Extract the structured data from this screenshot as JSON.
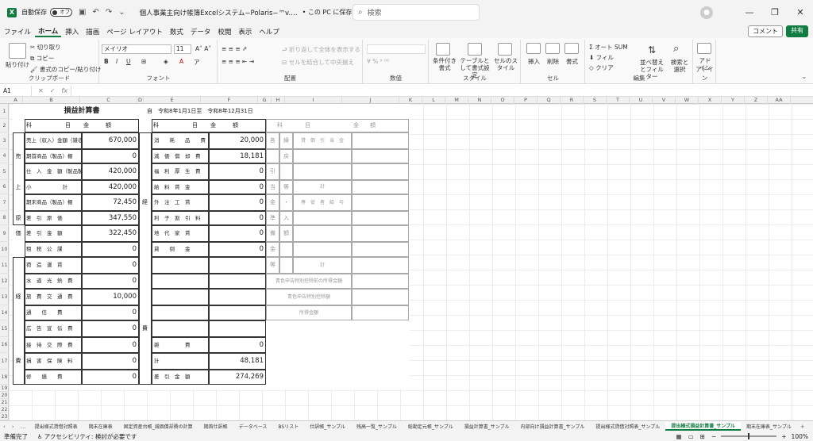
{
  "titlebar": {
    "autosave_label": "自動保存",
    "autosave_state": "オフ",
    "doc_title": "個人事業主向け帳簿Excelシステム−Polaris−™v.…",
    "save_location": "• この PC に保存済み",
    "search_placeholder": "検索"
  },
  "menu": {
    "items": [
      "ファイル",
      "ホーム",
      "挿入",
      "描画",
      "ページ レイアウト",
      "数式",
      "データ",
      "校閲",
      "表示",
      "ヘルプ"
    ],
    "comment": "コメント",
    "share": "共有"
  },
  "ribbon": {
    "clipboard": {
      "paste": "貼り付け",
      "cut": "切り取り",
      "copy": "コピー",
      "format_painter": "書式のコピー/貼り付け",
      "label": "クリップボード"
    },
    "font": {
      "name": "メイリオ",
      "size": "11",
      "label": "フォント"
    },
    "alignment": {
      "wrap": "折り返して全体を表示する",
      "merge": "セルを結合して中央揃え",
      "label": "配置"
    },
    "number": {
      "label": "数値"
    },
    "styles": {
      "conditional": "条件付き書式",
      "table": "テーブルとして書式設定",
      "cell_styles": "セルのスタイル",
      "label": "スタイル"
    },
    "cells": {
      "insert": "挿入",
      "delete": "削除",
      "format": "書式",
      "label": "セル"
    },
    "editing": {
      "autosum": "オート SUM",
      "fill": "フィル",
      "clear": "クリア",
      "sort": "並べ替えとフィルター",
      "find": "検索と選択",
      "label": "編集"
    },
    "addins": {
      "addin": "アドイン",
      "label": "アドイン"
    }
  },
  "formula": {
    "namebox": "A1",
    "fx": "fx"
  },
  "columns": [
    "A",
    "B",
    "C",
    "D",
    "E",
    "F",
    "G",
    "H",
    "I",
    "J",
    "K",
    "L",
    "M",
    "N",
    "O",
    "P",
    "Q",
    "R",
    "S",
    "T",
    "U",
    "V",
    "W",
    "X",
    "Y",
    "Z",
    "AA"
  ],
  "rows": [
    "1",
    "2",
    "3",
    "4",
    "5",
    "6",
    "7",
    "8",
    "9",
    "10",
    "11",
    "12",
    "13",
    "14",
    "15",
    "16",
    "17",
    "18",
    "19",
    "20",
    "21",
    "22",
    "23",
    "24",
    "25"
  ],
  "statement": {
    "title": "損益計算書",
    "period": "自　令和8年1月1日至　令和8年12月31日",
    "hdr_item": "科　　　　　　目",
    "hdr_amount": "金　　　額",
    "left_rows": [
      {
        "label": "売上（収入）金額（雑収入を含む）",
        "value": "670,000"
      },
      {
        "label": "期首商品（製品）棚　　卸　　高",
        "value": "0"
      },
      {
        "label": "仕　入　金　額（製品製造原価）",
        "value": "420,000"
      },
      {
        "label": "小　　　　　　計",
        "value": "420,000"
      },
      {
        "label": "期末商品（製品）棚　　卸　　高",
        "value": "72,450"
      },
      {
        "label": "差　引　原　価",
        "value": "347,550"
      },
      {
        "label": "差　引　金　額",
        "value": "322,450"
      },
      {
        "label": "租　税　公　課",
        "value": "0"
      },
      {
        "label": "荷　造　運　賃",
        "value": "0"
      },
      {
        "label": "水　道　光　熱　費",
        "value": "0"
      },
      {
        "label": "旅　費　交　通　費",
        "value": "10,000"
      },
      {
        "label": "通　　信　　費",
        "value": "0"
      },
      {
        "label": "広　告　宣　伝　費",
        "value": "0"
      },
      {
        "label": "接　待　交　際　費",
        "value": "0"
      },
      {
        "label": "損　害　保　険　料",
        "value": "0"
      },
      {
        "label": "修　　繕　　費",
        "value": "0"
      }
    ],
    "right_rows": [
      {
        "label": "消　　耗　　品　　費",
        "value": "20,000"
      },
      {
        "label": "減　価　償　却　費",
        "value": "18,181"
      },
      {
        "label": "福　利　厚　生　費",
        "value": "0"
      },
      {
        "label": "給　料　賃　金",
        "value": "0"
      },
      {
        "label": "外　注　工　賃",
        "value": "0"
      },
      {
        "label": "利　子　割　引　料",
        "value": "0"
      },
      {
        "label": "地　代　家　賃",
        "value": "0"
      },
      {
        "label": "貸　　倒　　金",
        "value": "0"
      },
      {
        "label": "",
        "value": ""
      },
      {
        "label": "",
        "value": ""
      },
      {
        "label": "",
        "value": ""
      },
      {
        "label": "",
        "value": ""
      },
      {
        "label": "",
        "value": ""
      },
      {
        "label": "雑　　　　　費",
        "value": "0"
      },
      {
        "label": "計",
        "value": "48,181"
      },
      {
        "label": "差　引　金　額",
        "value": "274,269"
      }
    ],
    "side_left": {
      "uri": "売",
      "ue": "上",
      "gen": "原",
      "ka": "価",
      "kei": "経",
      "hi": "費"
    },
    "side_mid": {
      "kei": "経",
      "hi": "費"
    },
    "far": {
      "hdr_item": "科　　　　目",
      "hdr_amount": "金　　額",
      "col_g": [
        "各",
        "",
        "引",
        "当",
        "金",
        "準",
        "備",
        "金",
        "等"
      ],
      "col_h": [
        "繰",
        "戻",
        "",
        "等",
        "・",
        "入",
        "額",
        "",
        ""
      ],
      "col_i_r3": "貸　倒　引　当　金",
      "col_i_r6": "計",
      "col_i_r7": "専　従　者　給　与",
      "col_i_r8": "貸　倒　引　当　金",
      "col_i_r11": "計",
      "blue1": "青色申告特別控除前の所得金額",
      "blue2": "青色申告特別控除額",
      "blue3": "所得金額"
    }
  },
  "sheets": [
    "提出様式貸借対照表",
    "期末在庫表",
    "固定資産台帳_減価償却費の計算",
    "期首仕訳帳",
    "データベース",
    "BSリスト",
    "仕訳帳_サンプル",
    "残高一覧_サンプル",
    "総勘定元帳_サンプル",
    "損益計算書_サンプル",
    "内部向け損益計算書_サンプル",
    "提出様式貸借対照表_サンプル",
    "提出様式損益計算書_サンプル",
    "期末在庫表_サンプル"
  ],
  "active_sheet": "提出様式損益計算書_サンプル",
  "status": {
    "ready": "準備完了",
    "accessibility": "アクセシビリティ: 検討が必要です",
    "zoom": "100%"
  }
}
